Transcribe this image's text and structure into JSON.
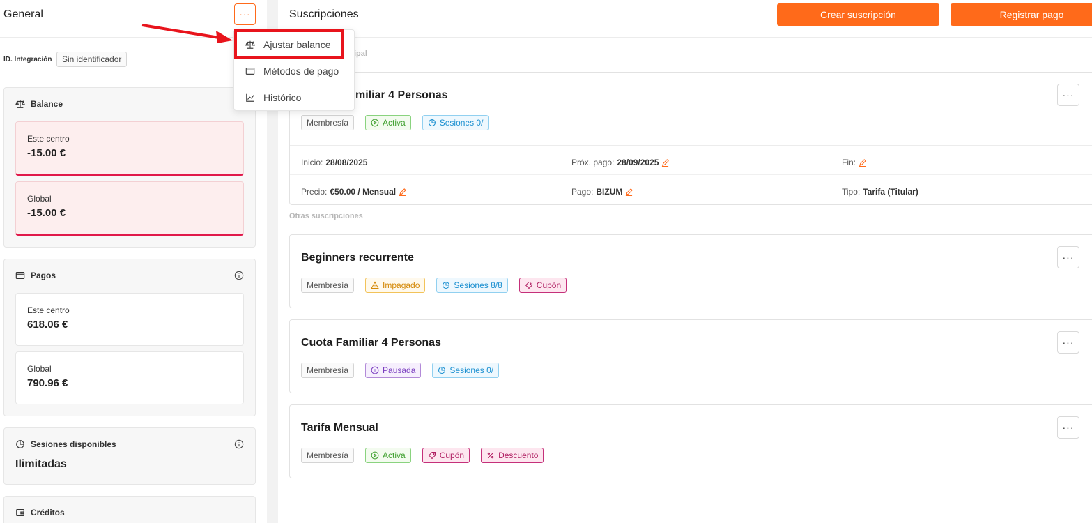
{
  "left": {
    "title": "General",
    "more_label": "···",
    "integration_label": "ID. Integración",
    "integration_value": "Sin identificador",
    "balance": {
      "title": "Balance",
      "center_label": "Este centro",
      "center_value": "-15.00 €",
      "global_label": "Global",
      "global_value": "-15.00 €"
    },
    "payments": {
      "title": "Pagos",
      "center_label": "Este centro",
      "center_value": "618.06 €",
      "global_label": "Global",
      "global_value": "790.96 €"
    },
    "sessions": {
      "title": "Sesiones disponibles",
      "value": "Ilimitadas"
    },
    "credits": {
      "title": "Créditos"
    }
  },
  "dropdown": {
    "items": [
      {
        "label": "Ajustar balance",
        "icon": "scale-icon"
      },
      {
        "label": "Métodos de pago",
        "icon": "card-icon"
      },
      {
        "label": "Histórico",
        "icon": "chart-icon"
      }
    ]
  },
  "right": {
    "title": "Suscripciones",
    "create_label": "Crear suscripción",
    "register_label": "Registrar pago",
    "main_section_label": "ipal",
    "other_section_label": "Otras suscripciones",
    "dots": "···",
    "main_sub": {
      "title": "miliar 4 Personas",
      "tags": [
        "Membresía",
        "Activa",
        "Sesiones 0/"
      ],
      "start_label": "Inicio:",
      "start_value": "28/08/2025",
      "next_label": "Próx. pago:",
      "next_value": "28/09/2025",
      "end_label": "Fin:",
      "price_label": "Precio:",
      "price_value": "€50.00 / Mensual",
      "pay_label": "Pago:",
      "pay_value": "BIZUM",
      "type_label": "Tipo:",
      "type_value": "Tarifa (Titular)"
    },
    "others": [
      {
        "title": "Beginners recurrente",
        "tags": [
          "Membresía",
          "Impagado",
          "Sesiones 8/8",
          "Cupón"
        ]
      },
      {
        "title": "Cuota Familiar 4 Personas",
        "tags": [
          "Membresía",
          "Pausada",
          "Sesiones 0/"
        ]
      },
      {
        "title": "Tarifa Mensual",
        "tags": [
          "Membresía",
          "Activa",
          "Cupón",
          "Descuento"
        ]
      }
    ]
  },
  "colors": {
    "accent": "#ff6a1a",
    "negative": "#e0194a",
    "highlight": "#e8141c"
  }
}
